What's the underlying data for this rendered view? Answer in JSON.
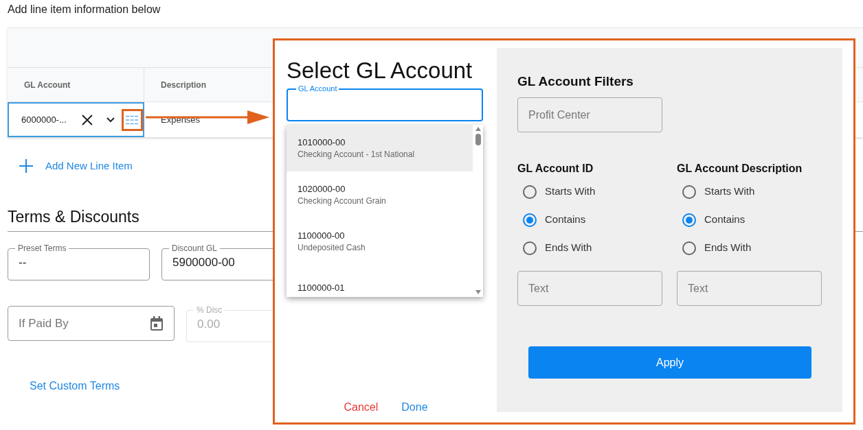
{
  "page_title": "Add line item information below",
  "line_items": {
    "columns": [
      "GL Account",
      "Description"
    ],
    "rows": [
      {
        "gl_account": "6000000-...",
        "description": "Expenses"
      }
    ]
  },
  "add_line_button": "Add New Line Item",
  "terms": {
    "title": "Terms & Discounts",
    "rows": [
      [
        {
          "kind": "text",
          "label": "Preset Terms",
          "value": "--"
        },
        {
          "kind": "text",
          "label": "Discount GL",
          "value": "5900000-00"
        }
      ],
      [
        {
          "kind": "date",
          "placeholder": "If Paid By"
        },
        {
          "kind": "readonly",
          "label": "% Disc",
          "value": "0.00"
        }
      ]
    ],
    "custom_terms_link": "Set Custom Terms"
  },
  "dialog": {
    "title": "Select GL Account",
    "search_field": {
      "label": "GL Account"
    },
    "options": [
      {
        "id": "1010000-00",
        "description": "Checking Account - 1st National",
        "selected": true
      },
      {
        "id": "1020000-00",
        "description": "Checking Account Grain",
        "selected": false
      },
      {
        "id": "1100000-00",
        "description": "Undeposited Cash",
        "selected": false
      },
      {
        "id": "1100000-01",
        "selected": false
      }
    ],
    "buttons": [
      {
        "kind": "cancel",
        "label": "Cancel"
      },
      {
        "kind": "confirm",
        "label": "Done"
      }
    ],
    "filters": {
      "title": "GL Account Filters",
      "profit_center": {
        "placeholder": "Profit Center"
      },
      "groups": [
        {
          "title": "GL Account ID",
          "options": [
            {
              "label": "Starts With",
              "selected": false
            },
            {
              "label": "Contains",
              "selected": true
            },
            {
              "label": "Ends With",
              "selected": false
            }
          ],
          "text": {
            "placeholder": "Text"
          }
        },
        {
          "title": "GL Account Description",
          "options": [
            {
              "label": "Starts With",
              "selected": false
            },
            {
              "label": "Contains",
              "selected": true
            },
            {
              "label": "Ends With",
              "selected": false
            }
          ],
          "text": {
            "placeholder": "Text"
          }
        }
      ],
      "apply_button": "Apply"
    }
  }
}
